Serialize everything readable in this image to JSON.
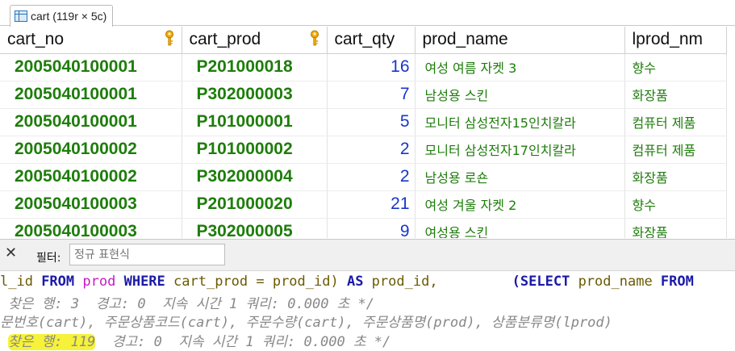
{
  "tab": {
    "label": "cart (119r × 5c)"
  },
  "columns": [
    {
      "name": "cart_no",
      "key": true
    },
    {
      "name": "cart_prod",
      "key": true
    },
    {
      "name": "cart_qty",
      "key": false
    },
    {
      "name": "prod_name",
      "key": false
    },
    {
      "name": "lprod_nm",
      "key": false
    }
  ],
  "rows": [
    {
      "cart_no": "2005040100001",
      "cart_prod": "P201000018",
      "cart_qty": "16",
      "prod_name": "여성 여름 자켓 3",
      "lprod_nm": "향수"
    },
    {
      "cart_no": "2005040100001",
      "cart_prod": "P302000003",
      "cart_qty": "7",
      "prod_name": "남성용 스킨",
      "lprod_nm": "화장품"
    },
    {
      "cart_no": "2005040100001",
      "cart_prod": "P101000001",
      "cart_qty": "5",
      "prod_name": "모니터 삼성전자15인치칼라",
      "lprod_nm": "컴퓨터 제품"
    },
    {
      "cart_no": "2005040100002",
      "cart_prod": "P101000002",
      "cart_qty": "2",
      "prod_name": "모니터 삼성전자17인치칼라",
      "lprod_nm": "컴퓨터 제품"
    },
    {
      "cart_no": "2005040100002",
      "cart_prod": "P302000004",
      "cart_qty": "2",
      "prod_name": "남성용 로숀",
      "lprod_nm": "화장품"
    },
    {
      "cart_no": "2005040100003",
      "cart_prod": "P201000020",
      "cart_qty": "21",
      "prod_name": "여성 겨울 자켓 2",
      "lprod_nm": "향수"
    },
    {
      "cart_no": "2005040100003",
      "cart_prod": "P302000005",
      "cart_qty": "9",
      "prod_name": "여성용 스킨",
      "lprod_nm": "화장품"
    }
  ],
  "filter": {
    "label": "필터:",
    "placeholder": "정규 표현식",
    "close": "✕"
  },
  "log": {
    "line1": {
      "a": "l_id ",
      "b": "FROM",
      "c": " ",
      "d": "prod",
      "e": " ",
      "f": "WHERE",
      "g": " cart_prod = prod_id) ",
      "h": "AS",
      "i": " prod_id,",
      "j": "         (SELECT",
      "k": " prod_name ",
      "l": "FROM"
    },
    "line2": " 찾은 행: 3  경고: 0  지속 시간 1 쿼리: 0.000 초 */",
    "line3": "문번호(cart), 주문상품코드(cart), 주문수량(cart), 주문상품명(prod), 상품분류명(lprod)",
    "line4_hl": "찾은 행: 119",
    "line4_rest": "  경고: 0  지속 시간 1 쿼리: 0.000 초 */",
    "highlight_color": "#f6f23a"
  },
  "colors": {
    "value_green": "#1e7d0b",
    "number_blue": "#1736c8",
    "key_gold": "#f2a900"
  }
}
